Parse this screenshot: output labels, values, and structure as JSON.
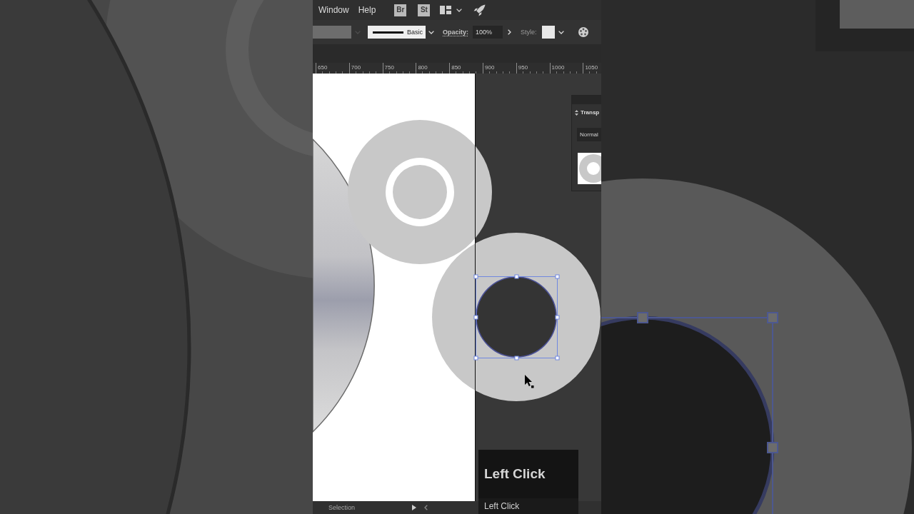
{
  "menu_bar": {
    "menus": [
      {
        "label": "Window"
      },
      {
        "label": "Help"
      }
    ],
    "app_buttons": [
      {
        "label": "Br"
      },
      {
        "label": "St"
      }
    ]
  },
  "control_bar": {
    "stroke_profile": "Basic",
    "opacity_label": "Opacity:",
    "opacity_value": "100%",
    "style_label": "Style:"
  },
  "ruler": {
    "labels": [
      "650",
      "700",
      "750",
      "800",
      "850",
      "900",
      "950",
      "1000",
      "1050"
    ]
  },
  "canvas": {
    "objects": [
      {
        "kind": "gradient_circle",
        "selected": false
      },
      {
        "kind": "ring_circle",
        "selected": false
      },
      {
        "kind": "disc",
        "selected": false
      },
      {
        "kind": "hole",
        "selected": true
      }
    ]
  },
  "transparency_panel": {
    "title": "Transp",
    "blend_mode": "Normal"
  },
  "status_bar": {
    "tool": "Selection"
  },
  "click_overlay": {
    "title": "Left Click",
    "caption": "Left Click"
  }
}
